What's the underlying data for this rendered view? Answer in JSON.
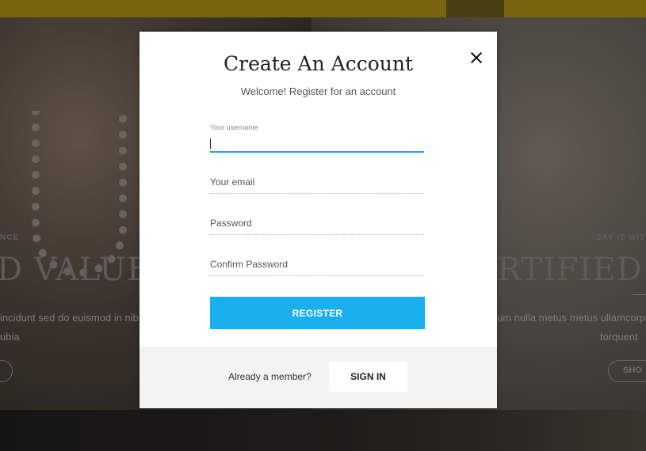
{
  "background": {
    "left_small_caps": "NCE",
    "left_headline": "D VALUE",
    "left_body_line1": "incidunt sed do euismod in nib",
    "left_body_line2": "ubia",
    "right_small_caps": "SAY IT WITH",
    "right_headline": "RTIFIED",
    "right_body_line1": "um nulla metus metus ullamcorp",
    "right_body_line2": "torquent",
    "right_button_label": "SHO"
  },
  "modal": {
    "title": "Create An Account",
    "subtitle": "Welcome! Register for an account",
    "username": {
      "label": "Your username",
      "value": ""
    },
    "email": {
      "placeholder": "Your email",
      "value": ""
    },
    "password": {
      "placeholder": "Password",
      "value": ""
    },
    "confirm_password": {
      "placeholder": "Confirm Password",
      "value": ""
    },
    "register_label": "REGISTER",
    "footer": {
      "member_text": "Already a member?",
      "signin_label": "SIGN IN"
    }
  },
  "colors": {
    "accent": "#1ab0ee",
    "topbar": "#7a6410"
  }
}
